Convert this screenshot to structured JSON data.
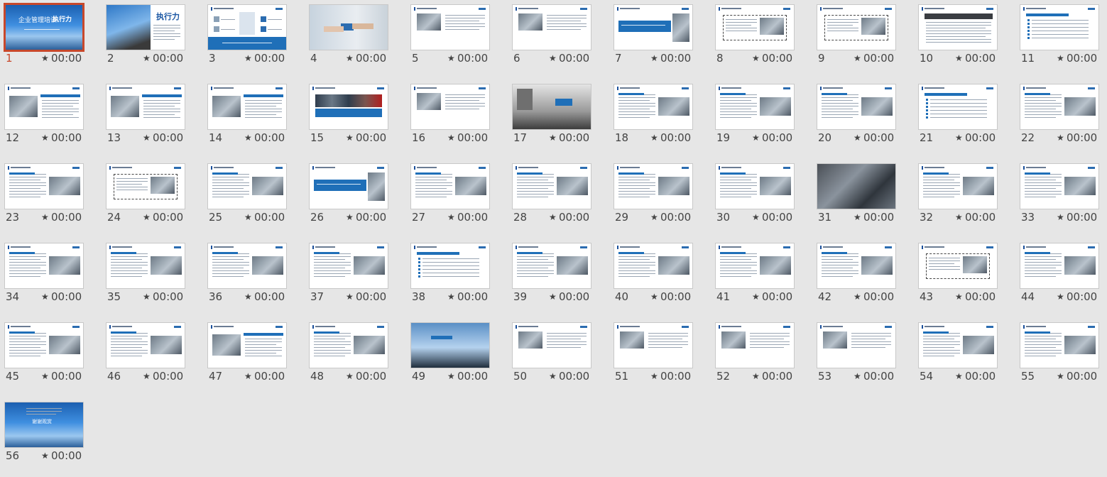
{
  "slides": [
    {
      "number": "1",
      "timing": "00:00",
      "selected": true,
      "variant": "title"
    },
    {
      "number": "2",
      "timing": "00:00",
      "variant": "title2"
    },
    {
      "number": "3",
      "timing": "00:00",
      "variant": "toc"
    },
    {
      "number": "4",
      "timing": "00:00",
      "variant": "hands"
    },
    {
      "number": "5",
      "timing": "00:00",
      "variant": "imgleft"
    },
    {
      "number": "6",
      "timing": "00:00",
      "variant": "imgleft"
    },
    {
      "number": "7",
      "timing": "00:00",
      "variant": "bluebanner"
    },
    {
      "number": "8",
      "timing": "00:00",
      "variant": "dashedbox"
    },
    {
      "number": "9",
      "timing": "00:00",
      "variant": "dashedbox"
    },
    {
      "number": "10",
      "timing": "00:00",
      "variant": "darkbox"
    },
    {
      "number": "11",
      "timing": "00:00",
      "variant": "textlist"
    },
    {
      "number": "12",
      "timing": "00:00",
      "variant": "imgleftbox"
    },
    {
      "number": "13",
      "timing": "00:00",
      "variant": "imgleftbox"
    },
    {
      "number": "14",
      "timing": "00:00",
      "variant": "imgleftbox"
    },
    {
      "number": "15",
      "timing": "00:00",
      "variant": "photostrip"
    },
    {
      "number": "16",
      "timing": "00:00",
      "variant": "imgleft"
    },
    {
      "number": "17",
      "timing": "00:00",
      "variant": "crowd"
    },
    {
      "number": "18",
      "timing": "00:00",
      "variant": "imgright"
    },
    {
      "number": "19",
      "timing": "00:00",
      "variant": "imgright"
    },
    {
      "number": "20",
      "timing": "00:00",
      "variant": "imgright"
    },
    {
      "number": "21",
      "timing": "00:00",
      "variant": "textlist"
    },
    {
      "number": "22",
      "timing": "00:00",
      "variant": "imgright"
    },
    {
      "number": "23",
      "timing": "00:00",
      "variant": "imgright"
    },
    {
      "number": "24",
      "timing": "00:00",
      "variant": "dashedbox"
    },
    {
      "number": "25",
      "timing": "00:00",
      "variant": "imgright"
    },
    {
      "number": "26",
      "timing": "00:00",
      "variant": "bluebanner"
    },
    {
      "number": "27",
      "timing": "00:00",
      "variant": "imgright"
    },
    {
      "number": "28",
      "timing": "00:00",
      "variant": "imgright"
    },
    {
      "number": "29",
      "timing": "00:00",
      "variant": "imgright"
    },
    {
      "number": "30",
      "timing": "00:00",
      "variant": "imgright"
    },
    {
      "number": "31",
      "timing": "00:00",
      "variant": "photo"
    },
    {
      "number": "32",
      "timing": "00:00",
      "variant": "imgright"
    },
    {
      "number": "33",
      "timing": "00:00",
      "variant": "imgright"
    },
    {
      "number": "34",
      "timing": "00:00",
      "variant": "imgright"
    },
    {
      "number": "35",
      "timing": "00:00",
      "variant": "imgright"
    },
    {
      "number": "36",
      "timing": "00:00",
      "variant": "imgright"
    },
    {
      "number": "37",
      "timing": "00:00",
      "variant": "imgright"
    },
    {
      "number": "38",
      "timing": "00:00",
      "variant": "textlist"
    },
    {
      "number": "39",
      "timing": "00:00",
      "variant": "imgright"
    },
    {
      "number": "40",
      "timing": "00:00",
      "variant": "imgright"
    },
    {
      "number": "41",
      "timing": "00:00",
      "variant": "imgright"
    },
    {
      "number": "42",
      "timing": "00:00",
      "variant": "imgright"
    },
    {
      "number": "43",
      "timing": "00:00",
      "variant": "dashedbox"
    },
    {
      "number": "44",
      "timing": "00:00",
      "variant": "imgright"
    },
    {
      "number": "45",
      "timing": "00:00",
      "variant": "imgright"
    },
    {
      "number": "46",
      "timing": "00:00",
      "variant": "imgright"
    },
    {
      "number": "47",
      "timing": "00:00",
      "variant": "imgleftbox"
    },
    {
      "number": "48",
      "timing": "00:00",
      "variant": "imgright"
    },
    {
      "number": "49",
      "timing": "00:00",
      "variant": "sky"
    },
    {
      "number": "50",
      "timing": "00:00",
      "variant": "imgleft"
    },
    {
      "number": "51",
      "timing": "00:00",
      "variant": "imgleft"
    },
    {
      "number": "52",
      "timing": "00:00",
      "variant": "imgleft"
    },
    {
      "number": "53",
      "timing": "00:00",
      "variant": "imgleft"
    },
    {
      "number": "54",
      "timing": "00:00",
      "variant": "imgright"
    },
    {
      "number": "55",
      "timing": "00:00",
      "variant": "imgright"
    },
    {
      "number": "56",
      "timing": "00:00",
      "variant": "end"
    }
  ],
  "colors": {
    "accent": "#c8482b",
    "brand_blue": "#1f6fb8",
    "background": "#e6e6e6"
  },
  "icons": {
    "timing": "star-icon"
  },
  "thumbnail_text": {
    "title_slide": "企业管理培训",
    "title_slide_word": "执行力",
    "slide2_word": "执行力",
    "end_slide": "谢谢观赏"
  }
}
